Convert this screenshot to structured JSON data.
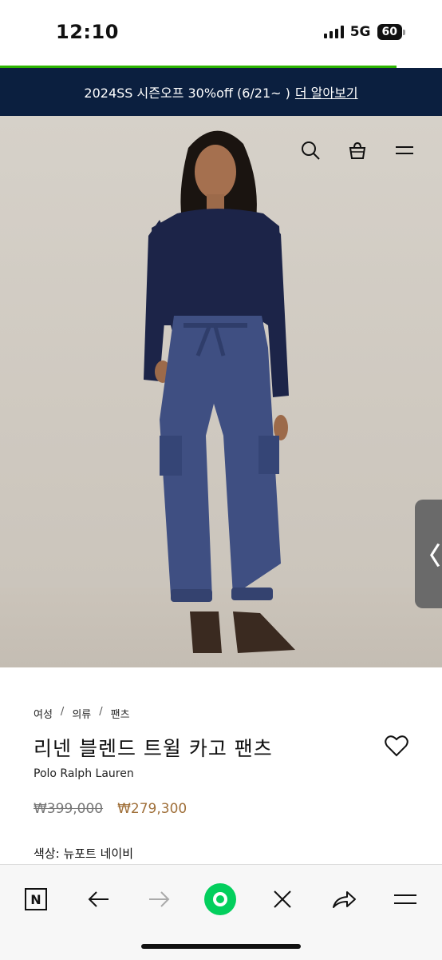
{
  "status_bar": {
    "time": "12:10",
    "network": "5G",
    "battery": "60"
  },
  "promo": {
    "text": "2024SS 시즌오프 30%off (6/21~ )",
    "link": "더 알아보기"
  },
  "header_icons": [
    "search-icon",
    "shopping-bag-icon",
    "menu-icon"
  ],
  "product": {
    "breadcrumb": [
      "여성",
      "의류",
      "팬츠"
    ],
    "breadcrumb_separator": "/",
    "title": "리넨 블렌드 트윌 카고 팬츠",
    "brand": "Polo Ralph Lauren",
    "original_price": "₩399,000",
    "sale_price": "₩279,300",
    "color_label": "색상:",
    "color_value": "뉴포트 네이비"
  },
  "side_tab": {
    "icon": "chevron-left-icon",
    "glyph": "〈"
  },
  "browser_bar": {
    "buttons": [
      "naver-n-icon",
      "back-arrow-icon",
      "forward-arrow-icon",
      "naver-green-circle-icon",
      "close-icon",
      "share-icon",
      "menu-icon"
    ],
    "n_label": "N"
  },
  "colors": {
    "promo_bg": "#0b1f3f",
    "sale_price": "#a0703a",
    "naver_green": "#03cf5d",
    "load_progress": "#2db400"
  }
}
